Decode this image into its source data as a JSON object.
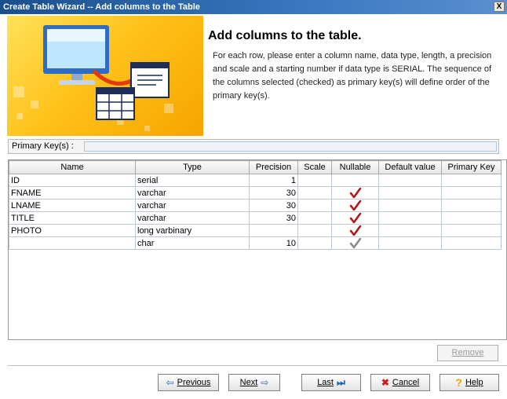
{
  "window": {
    "title": "Create Table Wizard -- Add columns to the Table",
    "close_label": "X"
  },
  "header": {
    "title": "Add columns to the table.",
    "description": "For each row, please enter a column name, data type, length, a precision and scale and a starting number if data type is SERIAL. The sequence of the columns selected (checked) as primary key(s) will define order of the primary key(s)."
  },
  "primary_keys": {
    "label": "Primary Key(s) :",
    "value": ""
  },
  "grid": {
    "columns": [
      "Name",
      "Type",
      "Precision",
      "Scale",
      "Nullable",
      "Default value",
      "Primary Key"
    ],
    "rows": [
      {
        "name": "ID",
        "type": "serial",
        "precision": "1",
        "scale": "",
        "nullable": false,
        "default": "",
        "primary_key": ""
      },
      {
        "name": "FNAME",
        "type": "varchar",
        "precision": "30",
        "scale": "",
        "nullable": true,
        "default": "",
        "primary_key": ""
      },
      {
        "name": "LNAME",
        "type": "varchar",
        "precision": "30",
        "scale": "",
        "nullable": true,
        "default": "",
        "primary_key": ""
      },
      {
        "name": "TITLE",
        "type": "varchar",
        "precision": "30",
        "scale": "",
        "nullable": true,
        "default": "",
        "primary_key": ""
      },
      {
        "name": "PHOTO",
        "type": "long varbinary",
        "precision": "",
        "scale": "",
        "nullable": true,
        "default": "",
        "primary_key": ""
      },
      {
        "name": "",
        "type": "char",
        "precision": "10",
        "scale": "",
        "nullable": true,
        "nullable_style": "gray",
        "default": "",
        "primary_key": ""
      }
    ]
  },
  "buttons": {
    "remove": "Remove",
    "previous": "Previous",
    "next": "Next",
    "last": "Last",
    "cancel": "Cancel",
    "help": "Help"
  },
  "colors": {
    "check_active": "#b01818",
    "check_inactive": "#8a8a8a",
    "title_bar": "#1a4f8c",
    "banner": "#ffc21a"
  }
}
